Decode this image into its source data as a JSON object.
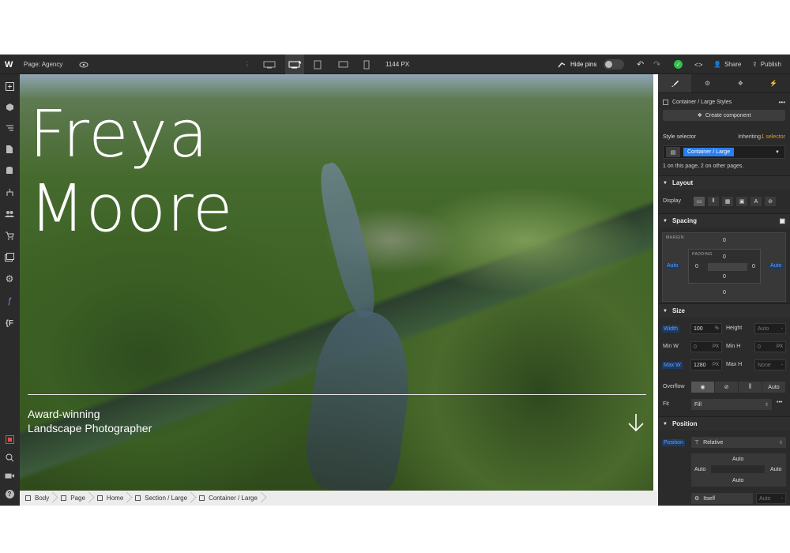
{
  "topbar": {
    "logo": "W",
    "page_label": "Page: Agency",
    "width_readout": "1144 PX",
    "hide_pins": "Hide pins",
    "share": "Share",
    "publish": "Publish"
  },
  "canvas": {
    "title_line1": "Freya",
    "title_line2": "Moore",
    "tagline_line1": "Award-winning",
    "tagline_line2": "Landscape Photographer"
  },
  "breadcrumb": [
    "Body",
    "Page",
    "Home",
    "Section / Large",
    "Container / Large"
  ],
  "panel": {
    "styles_header": "Container / Large Styles",
    "create_component": "Create component",
    "style_selector": "Style selector",
    "inheriting": "Inheriting",
    "inheriting_count": "1 selector",
    "selector_chip": "Container / Large",
    "usage": "1 on this page, 2 on other pages.",
    "layout": {
      "title": "Layout",
      "display": "Display"
    },
    "spacing": {
      "title": "Spacing",
      "margin_label": "MARGIN",
      "padding_label": "PADDING",
      "margin_top": "0",
      "margin_bottom": "0",
      "margin_left": "Auto",
      "margin_right": "Auto",
      "padding_top": "0",
      "padding_bottom": "0",
      "padding_left": "0",
      "padding_right": "0"
    },
    "size": {
      "title": "Size",
      "width": "Width",
      "width_val": "100",
      "width_unit": "%",
      "height": "Height",
      "height_val": "Auto",
      "min_w": "Min W",
      "min_w_val": "0",
      "min_w_unit": "PX",
      "min_h": "Min H",
      "min_h_val": "0",
      "min_h_unit": "PX",
      "max_w": "Max W",
      "max_w_val": "1280",
      "max_w_unit": "PX",
      "max_h": "Max H",
      "max_h_val": "None",
      "overflow": "Overflow",
      "overflow_auto": "Auto",
      "fit": "Fit",
      "fit_val": "Fill"
    },
    "position": {
      "title": "Position",
      "label": "Position",
      "value": "Relative",
      "top": "Auto",
      "left": "Auto",
      "right": "Auto",
      "bottom": "Auto",
      "relative_to": "Itself",
      "z": "Auto"
    }
  },
  "colors": {
    "accent": "#2a7ff0",
    "panel": "#2b2b2b",
    "success": "#2ec24a"
  }
}
